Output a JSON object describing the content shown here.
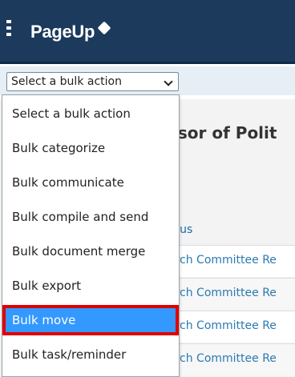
{
  "header": {
    "logo_text": "PageUp"
  },
  "bulk_action": {
    "selected_label": "Select a bulk action",
    "options": [
      "Select a bulk action",
      "Bulk categorize",
      "Bulk communicate",
      "Bulk compile and send",
      "Bulk document merge",
      "Bulk export",
      "Bulk move",
      "Bulk task/reminder"
    ],
    "highlighted_option": "Bulk move"
  },
  "background": {
    "page_title_fragment": "ssor of Polit",
    "column_header_fragment": "atus",
    "row_status_fragments": [
      "arch Committee Re",
      "arch Committee Re",
      "arch Committee Re",
      "arch Committee Re"
    ]
  },
  "colors": {
    "header_bg": "#1b3a5c",
    "selected_option_bg": "#3399ff",
    "highlight_outline": "#e00000",
    "link": "#2a7ab0"
  }
}
